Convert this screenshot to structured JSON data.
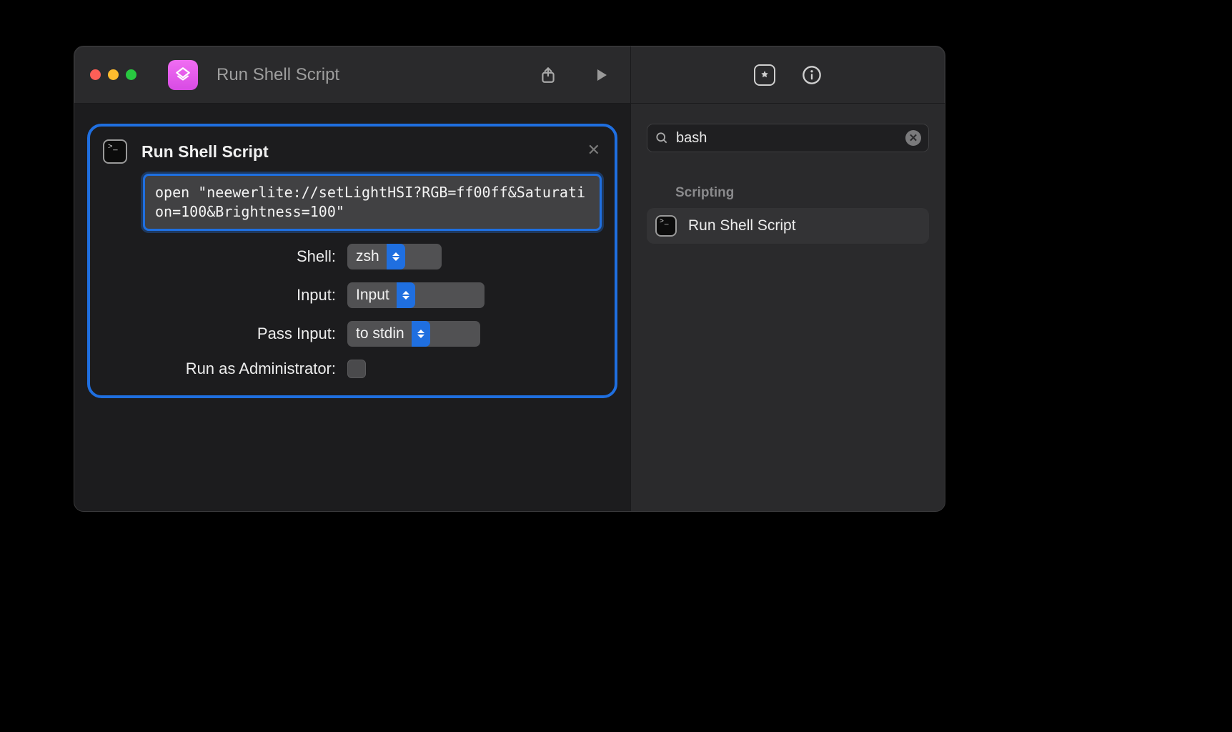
{
  "window": {
    "title": "Run Shell Script"
  },
  "toolbar": {
    "share_label": "Share",
    "run_label": "Run",
    "library_label": "Library",
    "info_label": "Info"
  },
  "action": {
    "title": "Run Shell Script",
    "script": "open \"neewerlite://setLightHSI?RGB=ff00ff&Saturation=100&Brightness=100\"",
    "fields": {
      "shell_label": "Shell:",
      "shell_value": "zsh",
      "input_label": "Input:",
      "input_value": "Input",
      "passinput_label": "Pass Input:",
      "passinput_value": "to stdin",
      "admin_label": "Run as Administrator:"
    }
  },
  "sidebar": {
    "search_value": "bash",
    "search_placeholder": "Search",
    "sections": [
      {
        "title": "Scripting",
        "items": [
          {
            "label": "Run Shell Script",
            "icon": "terminal-icon"
          }
        ]
      }
    ]
  },
  "colors": {
    "accent": "#1f6fe0",
    "app_icon_top": "#f06df2",
    "app_icon_bottom": "#d84be4"
  }
}
